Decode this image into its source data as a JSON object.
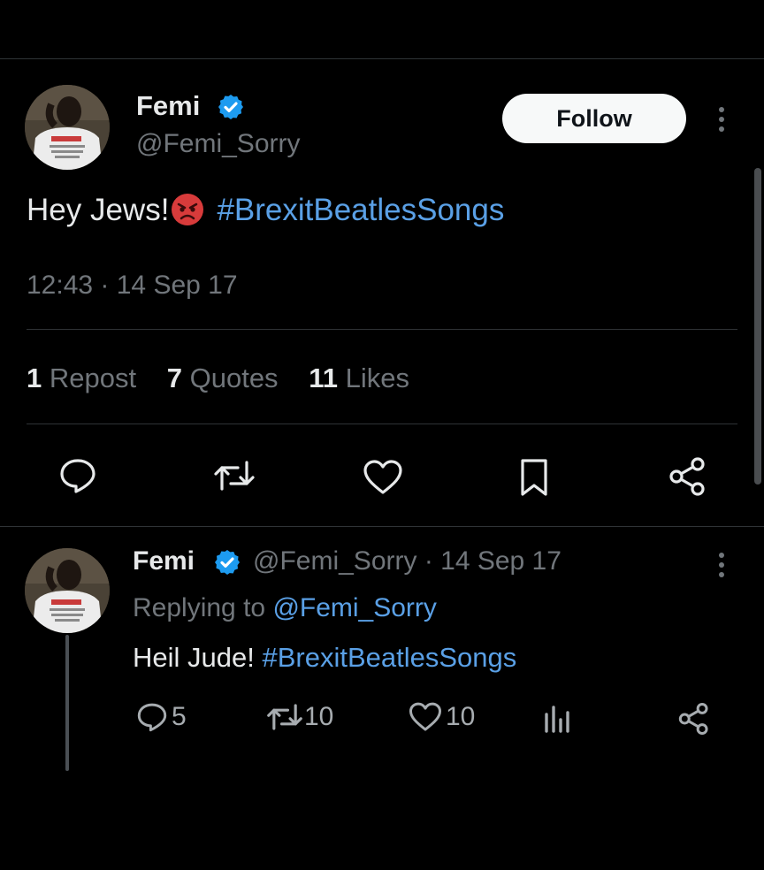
{
  "main_tweet": {
    "author_name": "Femi",
    "author_handle": "@Femi_Sorry",
    "follow_label": "Follow",
    "text_prefix": "Hey Jews!",
    "emoji_name": "angry-face-emoji",
    "hashtag": "#BrexitBeatlesSongs",
    "timestamp": "12:43 · 14 Sep 17",
    "stats": {
      "reposts_count": "1",
      "reposts_label": "Repost",
      "quotes_count": "7",
      "quotes_label": "Quotes",
      "likes_count": "11",
      "likes_label": "Likes"
    }
  },
  "reply_tweet": {
    "author_name": "Femi",
    "handle_date": "@Femi_Sorry · 14 Sep 17",
    "replying_prefix": "Replying to",
    "replying_handle": "@Femi_Sorry",
    "text_prefix": "Heil Jude!",
    "hashtag": "#BrexitBeatlesSongs",
    "replies": "5",
    "reposts": "10",
    "likes": "10"
  },
  "colors": {
    "background": "#000000",
    "text": "#e7e9ea",
    "muted": "#71767b",
    "link": "#5aa0e6",
    "verified": "#1d9bf0",
    "divider": "#2f3336"
  }
}
